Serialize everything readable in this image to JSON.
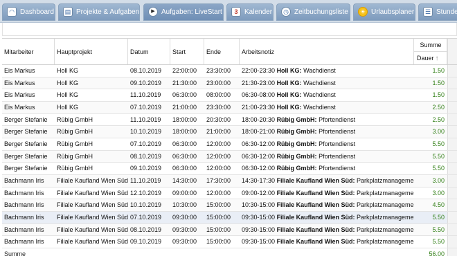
{
  "tabs": [
    {
      "label": "Dashboard",
      "icon": "dashboard-icon"
    },
    {
      "label": "Projekte & Aufgaben",
      "icon": "projects-icon"
    },
    {
      "label": "Aufgaben: LiveStart",
      "icon": "play-icon"
    },
    {
      "label": "Kalender",
      "icon": "calendar-icon"
    },
    {
      "label": "Zeitbuchungsliste",
      "icon": "clock-icon"
    },
    {
      "label": "Urlaubsplaner",
      "icon": "sun-icon"
    },
    {
      "label": "Stunden",
      "icon": "hours-icon"
    }
  ],
  "table": {
    "headers": {
      "mitarbeiter": "Mitarbeiter",
      "hauptprojekt": "Hauptprojekt",
      "datum": "Datum",
      "start": "Start",
      "ende": "Ende",
      "arbeitsnotiz": "Arbeitsnotiz",
      "summe": "Summe",
      "dauer": "Dauer",
      "sort_indicator": "↑"
    },
    "rows": [
      {
        "mitarbeiter": "Eis Markus",
        "hauptprojekt": "Holl KG",
        "datum": "08.10.2019",
        "start": "22:00:00",
        "ende": "23:30:00",
        "note_time": "22:00-23:30",
        "note_project": "Holl KG:",
        "note_task": "Wachdienst",
        "dauer": "1.50"
      },
      {
        "mitarbeiter": "Eis Markus",
        "hauptprojekt": "Holl KG",
        "datum": "09.10.2019",
        "start": "21:30:00",
        "ende": "23:00:00",
        "note_time": "21:30-23:00",
        "note_project": "Holl KG:",
        "note_task": "Wachdienst",
        "dauer": "1.50"
      },
      {
        "mitarbeiter": "Eis Markus",
        "hauptprojekt": "Holl KG",
        "datum": "11.10.2019",
        "start": "06:30:00",
        "ende": "08:00:00",
        "note_time": "06:30-08:00",
        "note_project": "Holl KG:",
        "note_task": "Wachdienst",
        "dauer": "1.50"
      },
      {
        "mitarbeiter": "Eis Markus",
        "hauptprojekt": "Holl KG",
        "datum": "07.10.2019",
        "start": "21:00:00",
        "ende": "23:30:00",
        "note_time": "21:00-23:30",
        "note_project": "Holl KG:",
        "note_task": "Wachdienst",
        "dauer": "2.50"
      },
      {
        "mitarbeiter": "Berger Stefanie",
        "hauptprojekt": "Rübig GmbH",
        "datum": "11.10.2019",
        "start": "18:00:00",
        "ende": "20:30:00",
        "note_time": "18:00-20:30",
        "note_project": "Rübig GmbH:",
        "note_task": "Pfortendienst",
        "dauer": "2.50"
      },
      {
        "mitarbeiter": "Berger Stefanie",
        "hauptprojekt": "Rübig GmbH",
        "datum": "10.10.2019",
        "start": "18:00:00",
        "ende": "21:00:00",
        "note_time": "18:00-21:00",
        "note_project": "Rübig GmbH:",
        "note_task": "Pfortendienst",
        "dauer": "3.00"
      },
      {
        "mitarbeiter": "Berger Stefanie",
        "hauptprojekt": "Rübig GmbH",
        "datum": "07.10.2019",
        "start": "06:30:00",
        "ende": "12:00:00",
        "note_time": "06:30-12:00",
        "note_project": "Rübig GmbH:",
        "note_task": "Pfortendienst",
        "dauer": "5.50"
      },
      {
        "mitarbeiter": "Berger Stefanie",
        "hauptprojekt": "Rübig GmbH",
        "datum": "08.10.2019",
        "start": "06:30:00",
        "ende": "12:00:00",
        "note_time": "06:30-12:00",
        "note_project": "Rübig GmbH:",
        "note_task": "Pfortendienst",
        "dauer": "5.50"
      },
      {
        "mitarbeiter": "Berger Stefanie",
        "hauptprojekt": "Rübig GmbH",
        "datum": "09.10.2019",
        "start": "06:30:00",
        "ende": "12:00:00",
        "note_time": "06:30-12:00",
        "note_project": "Rübig GmbH:",
        "note_task": "Pfortendienst",
        "dauer": "5.50"
      },
      {
        "mitarbeiter": "Bachmann Iris",
        "hauptprojekt": "Filiale Kaufland Wien Süd",
        "datum": "11.10.2019",
        "start": "14:30:00",
        "ende": "17:30:00",
        "note_time": "14:30-17:30",
        "note_project": "Filiale Kaufland Wien Süd:",
        "note_task": "Parkplatzmanagement",
        "dauer": "3.00"
      },
      {
        "mitarbeiter": "Bachmann Iris",
        "hauptprojekt": "Filiale Kaufland Wien Süd",
        "datum": "12.10.2019",
        "start": "09:00:00",
        "ende": "12:00:00",
        "note_time": "09:00-12:00",
        "note_project": "Filiale Kaufland Wien Süd:",
        "note_task": "Parkplatzmanagement",
        "dauer": "3.00"
      },
      {
        "mitarbeiter": "Bachmann Iris",
        "hauptprojekt": "Filiale Kaufland Wien Süd",
        "datum": "10.10.2019",
        "start": "10:30:00",
        "ende": "15:00:00",
        "note_time": "10:30-15:00",
        "note_project": "Filiale Kaufland Wien Süd:",
        "note_task": "Parkplatzmanagement",
        "dauer": "4.50"
      },
      {
        "mitarbeiter": "Bachmann Iris",
        "hauptprojekt": "Filiale Kaufland Wien Süd",
        "datum": "07.10.2019",
        "start": "09:30:00",
        "ende": "15:00:00",
        "note_time": "09:30-15:00",
        "note_project": "Filiale Kaufland Wien Süd:",
        "note_task": "Parkplatzmanagement",
        "dauer": "5.50"
      },
      {
        "mitarbeiter": "Bachmann Iris",
        "hauptprojekt": "Filiale Kaufland Wien Süd",
        "datum": "08.10.2019",
        "start": "09:30:00",
        "ende": "15:00:00",
        "note_time": "09:30-15:00",
        "note_project": "Filiale Kaufland Wien Süd:",
        "note_task": "Parkplatzmanagement",
        "dauer": "5.50"
      },
      {
        "mitarbeiter": "Bachmann Iris",
        "hauptprojekt": "Filiale Kaufland Wien Süd",
        "datum": "09.10.2019",
        "start": "09:30:00",
        "ende": "15:00:00",
        "note_time": "09:30-15:00",
        "note_project": "Filiale Kaufland Wien Süd:",
        "note_task": "Parkplatzmanagement",
        "dauer": "5.50"
      }
    ],
    "footer": {
      "label": "Summe",
      "total": "56.00"
    }
  }
}
